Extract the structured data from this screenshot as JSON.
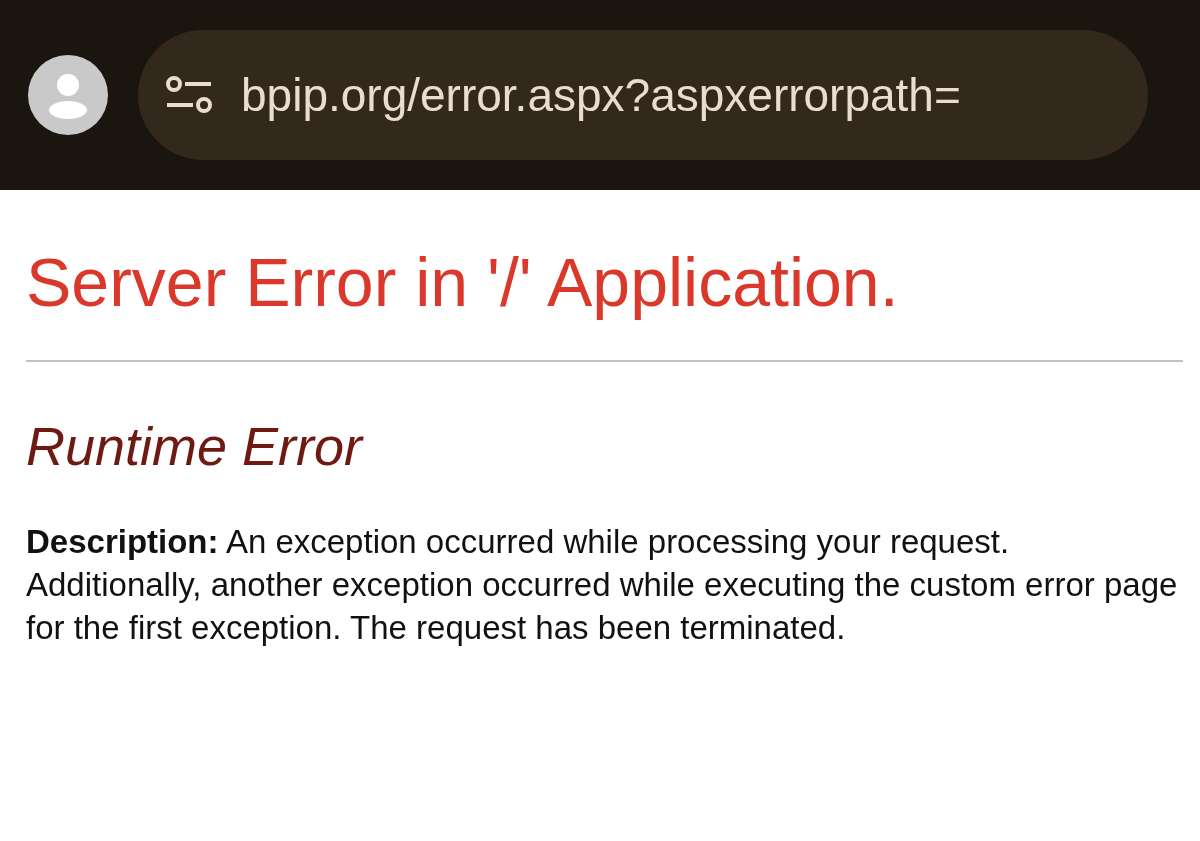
{
  "address_bar": {
    "url": "bpip.org/error.aspx?aspxerrorpath="
  },
  "heading": "Server Error in '/' Application.",
  "error_title": "Runtime Error",
  "description": "**Description:** An exception occurred while processing your request. Additionally, another exception occurred while executing the custom error page for the first exception. The request has been terminated."
}
